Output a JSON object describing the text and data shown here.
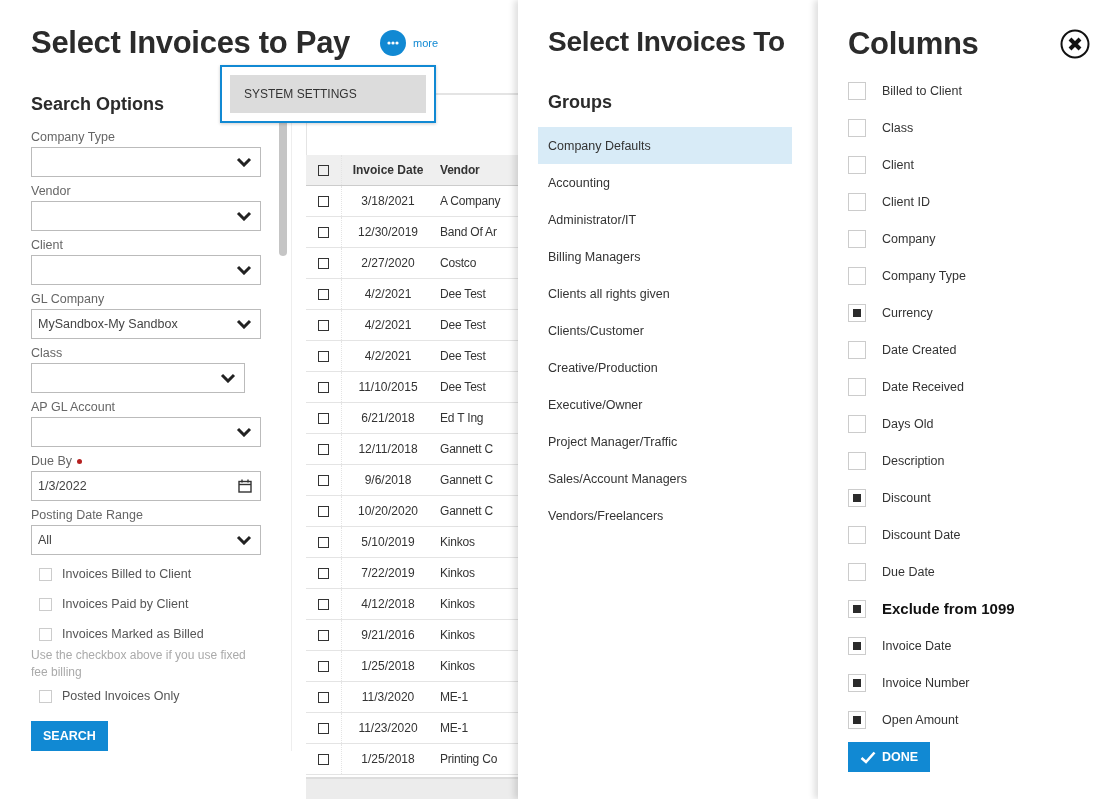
{
  "page": {
    "title": "Select Invoices to Pay",
    "more_label": "more",
    "menu": [
      {
        "label": "SYSTEM SETTINGS",
        "selected": true
      }
    ]
  },
  "search_options": {
    "title": "Search Options",
    "items": [
      {
        "kind": "select",
        "label": "Company Type"
      },
      {
        "kind": "select",
        "label": "Vendor"
      },
      {
        "kind": "select",
        "label": "Client"
      },
      {
        "kind": "select",
        "label": "GL Company",
        "value": "MySandbox-My Sandbox"
      },
      {
        "kind": "select",
        "label": "Class",
        "narrow": true
      },
      {
        "kind": "select",
        "label": "AP GL Account"
      },
      {
        "kind": "date",
        "label": "Due By",
        "required": true,
        "value": "1/3/2022"
      },
      {
        "kind": "select",
        "label": "Posting Date Range",
        "value": "All"
      },
      {
        "kind": "checkbox",
        "label": "Invoices Billed to Client",
        "checked": false
      },
      {
        "kind": "checkbox",
        "label": "Invoices Paid by Client",
        "checked": false
      },
      {
        "kind": "checkbox",
        "label": "Invoices Marked as Billed",
        "checked": false
      },
      {
        "kind": "note",
        "label": "Use the checkbox above if you use fixed fee billing"
      },
      {
        "kind": "checkbox",
        "label": "Posted Invoices Only",
        "checked": false
      }
    ],
    "button": "SEARCH"
  },
  "table": {
    "columns": [
      "Invoice Date",
      "Vendor"
    ],
    "header_checked": false,
    "rows": [
      {
        "checked": false,
        "cells": [
          "3/18/2021",
          "A Company"
        ]
      },
      {
        "checked": false,
        "cells": [
          "12/30/2019",
          "Band Of Ar"
        ]
      },
      {
        "checked": false,
        "cells": [
          "2/27/2020",
          "Costco"
        ]
      },
      {
        "checked": false,
        "cells": [
          "4/2/2021",
          "Dee Test"
        ]
      },
      {
        "checked": false,
        "cells": [
          "4/2/2021",
          "Dee Test"
        ]
      },
      {
        "checked": false,
        "cells": [
          "4/2/2021",
          "Dee Test"
        ]
      },
      {
        "checked": false,
        "cells": [
          "11/10/2015",
          "Dee Test"
        ]
      },
      {
        "checked": false,
        "cells": [
          "6/21/2018",
          "Ed T Ing"
        ]
      },
      {
        "checked": false,
        "cells": [
          "12/11/2018",
          "Gannett C"
        ]
      },
      {
        "checked": false,
        "cells": [
          "9/6/2018",
          "Gannett C"
        ]
      },
      {
        "checked": false,
        "cells": [
          "10/20/2020",
          "Gannett C"
        ]
      },
      {
        "checked": false,
        "cells": [
          "5/10/2019",
          "Kinkos"
        ]
      },
      {
        "checked": false,
        "cells": [
          "7/22/2019",
          "Kinkos"
        ]
      },
      {
        "checked": false,
        "cells": [
          "4/12/2018",
          "Kinkos"
        ]
      },
      {
        "checked": false,
        "cells": [
          "9/21/2016",
          "Kinkos"
        ]
      },
      {
        "checked": false,
        "cells": [
          "1/25/2018",
          "Kinkos"
        ]
      },
      {
        "checked": false,
        "cells": [
          "11/3/2020",
          "ME-1"
        ]
      },
      {
        "checked": false,
        "cells": [
          "11/23/2020",
          "ME-1"
        ]
      },
      {
        "checked": false,
        "cells": [
          "1/25/2018",
          "Printing Co"
        ]
      }
    ]
  },
  "groups_panel": {
    "title": "Select Invoices To",
    "heading": "Groups",
    "items": [
      {
        "label": "Company Defaults",
        "selected": true
      },
      {
        "label": "Accounting",
        "selected": false
      },
      {
        "label": "Administrator/IT",
        "selected": false
      },
      {
        "label": "Billing Managers",
        "selected": false
      },
      {
        "label": "Clients all rights given",
        "selected": false
      },
      {
        "label": "Clients/Customer",
        "selected": false
      },
      {
        "label": "Creative/Production",
        "selected": false
      },
      {
        "label": "Executive/Owner",
        "selected": false
      },
      {
        "label": "Project Manager/Traffic",
        "selected": false
      },
      {
        "label": "Sales/Account Managers",
        "selected": false
      },
      {
        "label": "Vendors/Freelancers",
        "selected": false
      }
    ]
  },
  "columns_panel": {
    "title": "Columns",
    "items": [
      {
        "label": "Billed to Client",
        "checked": false,
        "bold": false
      },
      {
        "label": "Class",
        "checked": false,
        "bold": false
      },
      {
        "label": "Client",
        "checked": false,
        "bold": false
      },
      {
        "label": "Client ID",
        "checked": false,
        "bold": false
      },
      {
        "label": "Company",
        "checked": false,
        "bold": false
      },
      {
        "label": "Company Type",
        "checked": false,
        "bold": false
      },
      {
        "label": "Currency",
        "checked": true,
        "bold": false
      },
      {
        "label": "Date Created",
        "checked": false,
        "bold": false
      },
      {
        "label": "Date Received",
        "checked": false,
        "bold": false
      },
      {
        "label": "Days Old",
        "checked": false,
        "bold": false
      },
      {
        "label": "Description",
        "checked": false,
        "bold": false
      },
      {
        "label": "Discount",
        "checked": true,
        "bold": false
      },
      {
        "label": "Discount Date",
        "checked": false,
        "bold": false
      },
      {
        "label": "Due Date",
        "checked": false,
        "bold": false
      },
      {
        "label": "Exclude from 1099",
        "checked": true,
        "bold": true
      },
      {
        "label": "Invoice Date",
        "checked": true,
        "bold": false
      },
      {
        "label": "Invoice Number",
        "checked": true,
        "bold": false
      },
      {
        "label": "Open Amount",
        "checked": true,
        "bold": false
      }
    ],
    "button": "DONE"
  }
}
